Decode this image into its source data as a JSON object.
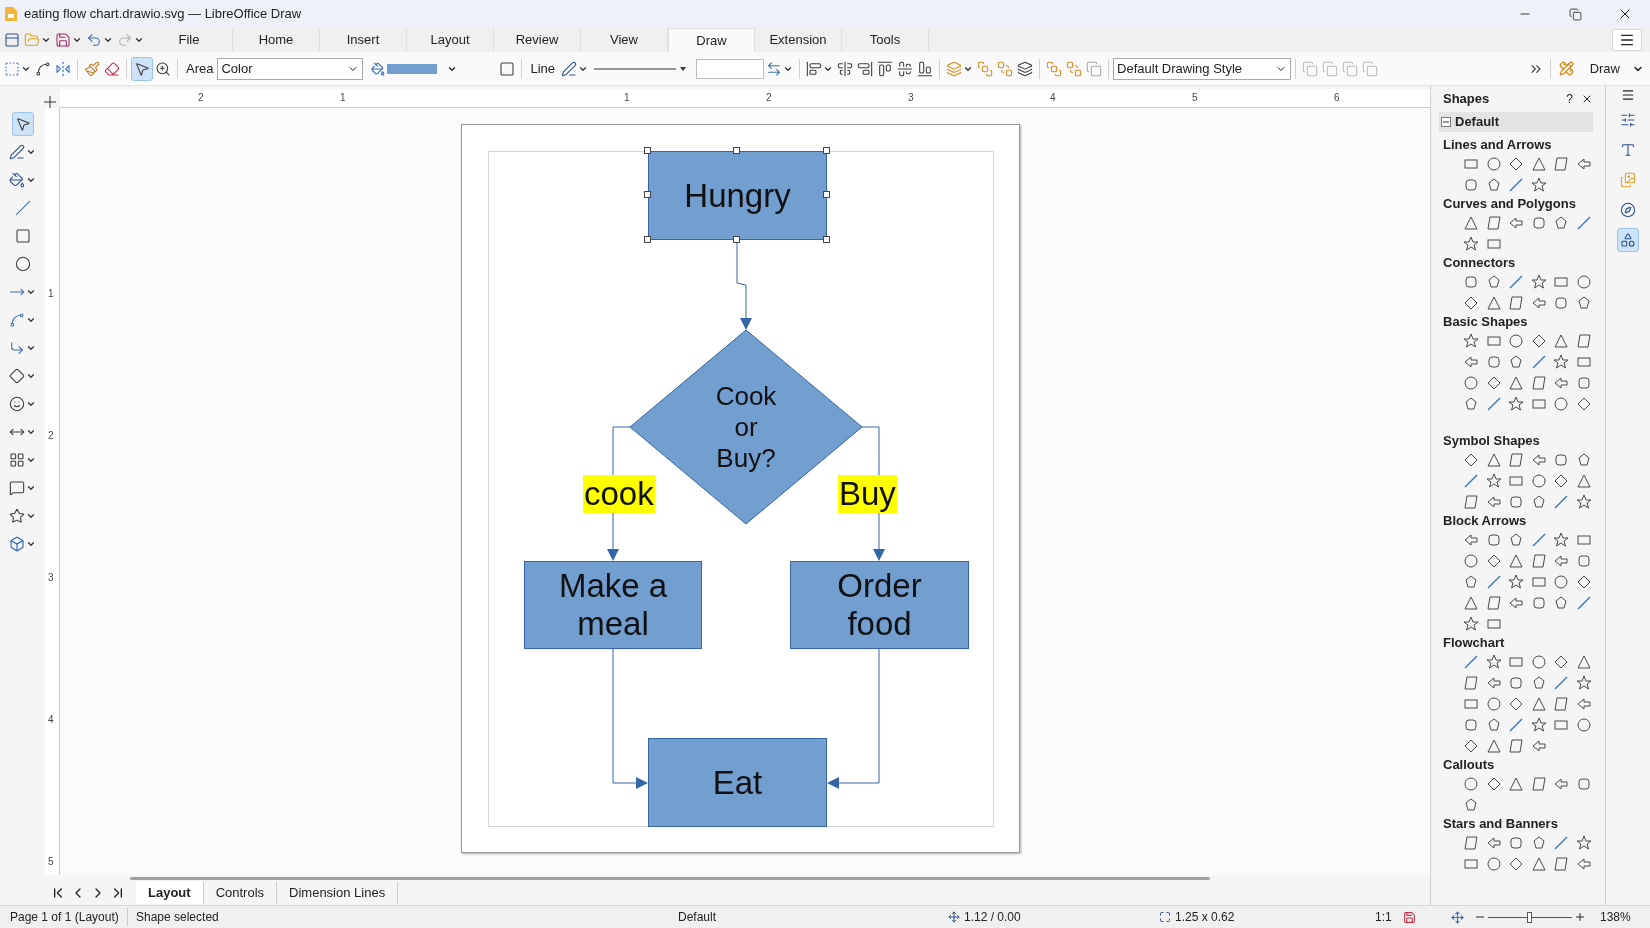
{
  "window": {
    "title": "eating flow chart.drawio.svg — LibreOffice Draw"
  },
  "menu_tabs": [
    {
      "label": "File",
      "selected": false
    },
    {
      "label": "Home",
      "selected": false
    },
    {
      "label": "Insert",
      "selected": false
    },
    {
      "label": "Layout",
      "selected": false
    },
    {
      "label": "Review",
      "selected": false
    },
    {
      "label": "View",
      "selected": false
    },
    {
      "label": "Draw",
      "selected": true
    },
    {
      "label": "Extension",
      "selected": false
    },
    {
      "label": "Tools",
      "selected": false
    }
  ],
  "toolbar": {
    "area_label": "Area",
    "area_value": "Color",
    "line_label": "Line",
    "style_value": "Default Drawing Style",
    "draw_button": "Draw"
  },
  "rulers": {
    "horizontal": [
      "2",
      "1",
      "1",
      "2",
      "3",
      "4",
      "5",
      "6"
    ],
    "vertical": [
      "1",
      "2",
      "3",
      "4",
      "5"
    ]
  },
  "diagram": {
    "start": "Hungry",
    "decision": "Cook\nor\nBuy?",
    "left_label": "cook",
    "right_label": "Buy",
    "left_action": "Make a\nmeal",
    "right_action": "Order\nfood",
    "end": "Eat"
  },
  "sidebar": {
    "title": "Shapes",
    "help": "?",
    "category": {
      "label": "Default",
      "expanded": true
    },
    "sections": [
      {
        "title": "Lines and Arrows"
      },
      {
        "title": "Curves and Polygons"
      },
      {
        "title": "Connectors"
      },
      {
        "title": "Basic Shapes"
      },
      {
        "title": "Symbol Shapes"
      },
      {
        "title": "Block Arrows"
      },
      {
        "title": "Flowchart"
      },
      {
        "title": "Callouts"
      },
      {
        "title": "Stars and Banners"
      }
    ]
  },
  "page_tabs": [
    {
      "label": "Layout",
      "selected": true
    },
    {
      "label": "Controls",
      "selected": false
    },
    {
      "label": "Dimension Lines",
      "selected": false
    }
  ],
  "status_bar": {
    "page": "Page 1 of 1 (Layout)",
    "selection": "Shape selected",
    "style": "Default",
    "position": "1.12 / 0.00",
    "size": "1.25 x 0.62",
    "scale": "1:1",
    "zoom_slider": {
      "level": 0.5
    },
    "zoom": "138%"
  }
}
